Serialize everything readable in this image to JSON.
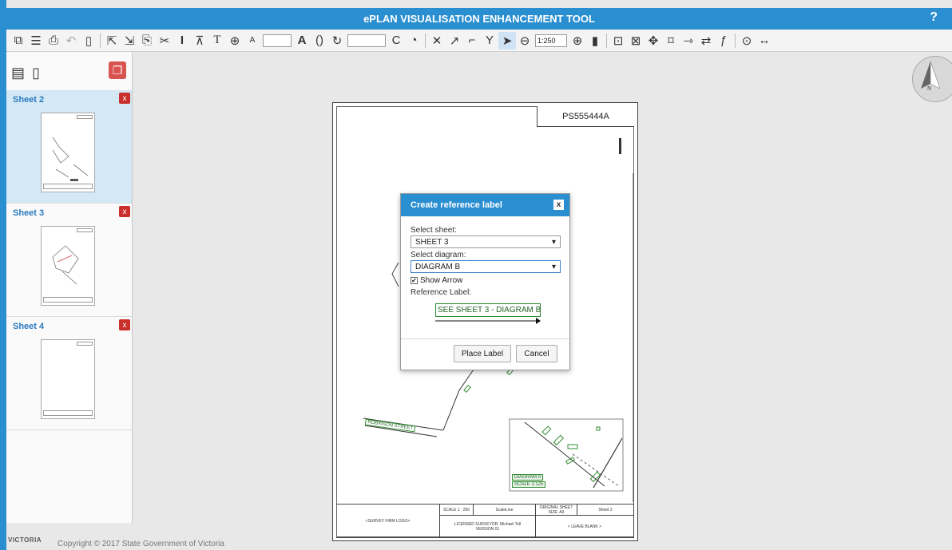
{
  "app": {
    "title": "ePLAN VISUALISATION ENHANCEMENT TOOL",
    "help": "?"
  },
  "toolbar": {
    "scale_value": "1:250",
    "icons": [
      "layers-icon",
      "menu-icon",
      "print-icon",
      "undo-icon",
      "new-sheet-icon",
      "select-icon",
      "select-plus-icon",
      "copy-icon",
      "cut-icon",
      "line-icon",
      "dimension-icon",
      "text-icon",
      "search-zoom-icon",
      "font-size-icon",
      "bold-a-icon",
      "arc-icon",
      "rotate-icon",
      "rotate-left-icon",
      "curve-icon",
      "delete-icon",
      "arrow-icon",
      "bend-icon",
      "fork-icon",
      "pointer-icon",
      "zoom-out-icon",
      "zoom-in-icon",
      "export-icon",
      "add-box-icon",
      "delete-box-icon",
      "move-icon",
      "fit-icon",
      "arrow-right-icon",
      "swap-icon",
      "function-icon",
      "pan-icon",
      "expand-icon"
    ]
  },
  "panel": {
    "sheets": [
      {
        "label": "Sheet 2",
        "close": "x",
        "selected": true
      },
      {
        "label": "Sheet 3",
        "close": "x",
        "selected": false
      },
      {
        "label": "Sheet 4",
        "close": "x",
        "selected": false
      }
    ]
  },
  "plan": {
    "plan_number": "PS555444A",
    "street_name": "ROBINSON STREET",
    "diagram_label": "DIAGRAM A",
    "diagram_scale": "SCALE 1:125",
    "footer": {
      "logo": "<SURVEY FIRM LOGO>",
      "scale_label": "SCALE",
      "scale_value": "1 : 250",
      "scaleline": "ScaleLine",
      "orig_sheet": "ORIGINAL SHEET SIZE: A3",
      "sheet": "Sheet 2",
      "surveyor": "LICENSED SURVEYOR: Michael Toll",
      "version": "VERSION 01",
      "blank": "< LEAVE BLANK >"
    }
  },
  "dialog": {
    "title": "Create reference label",
    "close": "x",
    "sheet_label": "Select sheet:",
    "sheet_value": "SHEET 3",
    "diagram_label": "Select diagram:",
    "diagram_value": "DIAGRAM B",
    "show_arrow_label": "Show Arrow",
    "show_arrow_checked": true,
    "reference_label": "Reference Label:",
    "preview": "SEE SHEET 3 - DIAGRAM B",
    "place_button": "Place Label",
    "cancel_button": "Cancel"
  },
  "compass": "N",
  "footer": {
    "copyright": "Copyright © 2017 State Government of Victoria",
    "logo": "VICTORIA"
  }
}
